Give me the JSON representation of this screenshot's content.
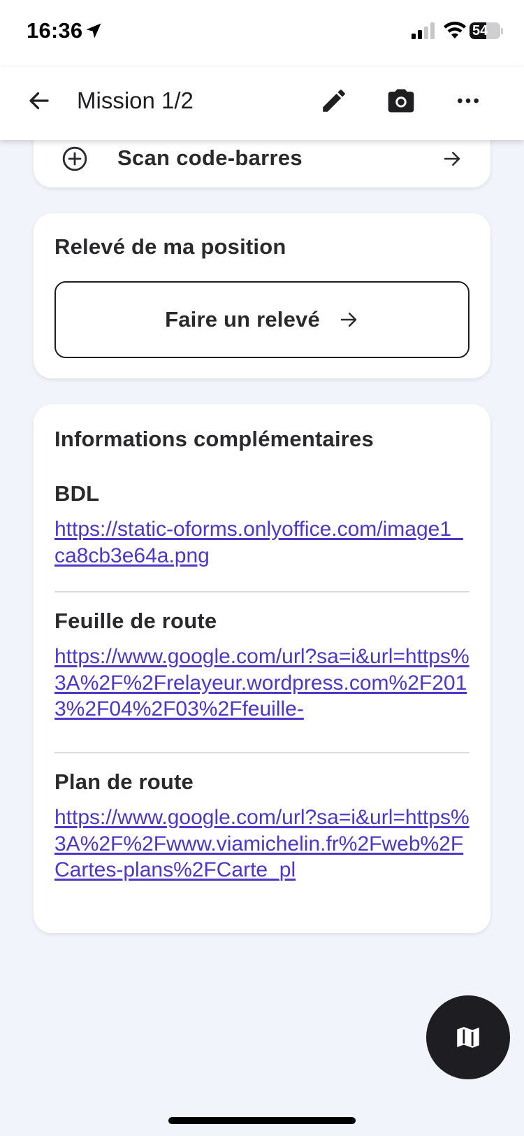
{
  "status_bar": {
    "time": "16:36",
    "battery_level": "54",
    "icons": [
      "location-arrow-icon",
      "cellular-signal-icon",
      "wifi-icon",
      "battery-icon"
    ]
  },
  "app_bar": {
    "title": "Mission 1/2",
    "icons": [
      "back-arrow-icon",
      "pencil-icon",
      "camera-icon",
      "more-horizontal-icon"
    ]
  },
  "scan_card": {
    "label": "Scan code-barres",
    "icons": [
      "plus-circle-icon",
      "arrow-right-icon"
    ]
  },
  "position_card": {
    "title": "Relevé de ma position",
    "button_label": "Faire un relevé"
  },
  "info_card": {
    "title": "Informations complémentaires",
    "items": [
      {
        "label": "BDL",
        "link": "https://static-oforms.onlyoffice.com/image1_ca8cb3e64a.png"
      },
      {
        "label": "Feuille de route",
        "link": "https://www.google.com/url?sa=i&url=https%3A%2F%2Frelayeur.wordpress.com%2F2013%2F04%2F03%2Ffeuille-"
      },
      {
        "label": "Plan de route",
        "link": "https://www.google.com/url?sa=i&url=https%3A%2F%2Fwww.viamichelin.fr%2Fweb%2FCartes-plans%2FCarte_pl"
      }
    ]
  },
  "fab": {
    "icon": "map-icon"
  },
  "colors": {
    "background": "#f1f4fa",
    "card": "#ffffff",
    "link": "#4d37c9",
    "text": "#1f1f22",
    "fab": "#1d1d22"
  }
}
